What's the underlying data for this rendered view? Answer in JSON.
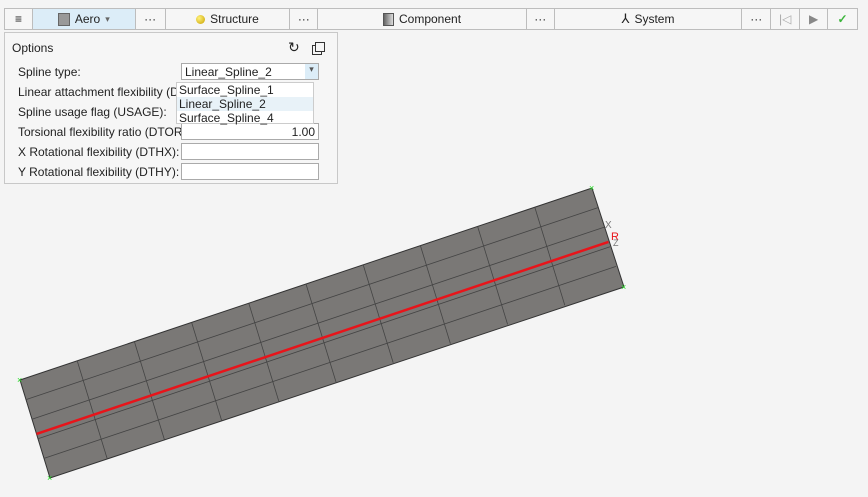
{
  "toolbar": {
    "menu_icon": "hamburger-icon",
    "aero": "Aero",
    "structure": "Structure",
    "component": "Component",
    "system": "System",
    "more": "···"
  },
  "options": {
    "title": "Options",
    "spline_type_label": "Spline type:",
    "spline_type_value": "Linear_Spline_2",
    "dz_label": "Linear attachment flexibility (DZ):",
    "usage_label": "Spline usage flag (USAGE):",
    "dtor_label": "Torsional flexibility ratio (DTOR):",
    "dtor_value": "1.00",
    "dthx_label": "X Rotational flexibility (DTHX):",
    "dthx_value": "",
    "dthy_label": "Y Rotational flexibility (DTHY):",
    "dthy_value": "",
    "dropdown_options": [
      "Surface_Spline_1",
      "Linear_Spline_2",
      "Surface_Spline_4"
    ]
  },
  "viewport": {
    "triad_x": "X",
    "triad_z": "Z",
    "marker": "R",
    "colors": {
      "mesh": "#7a7876",
      "spline": "#e8141a",
      "node": "#22dd22"
    }
  }
}
